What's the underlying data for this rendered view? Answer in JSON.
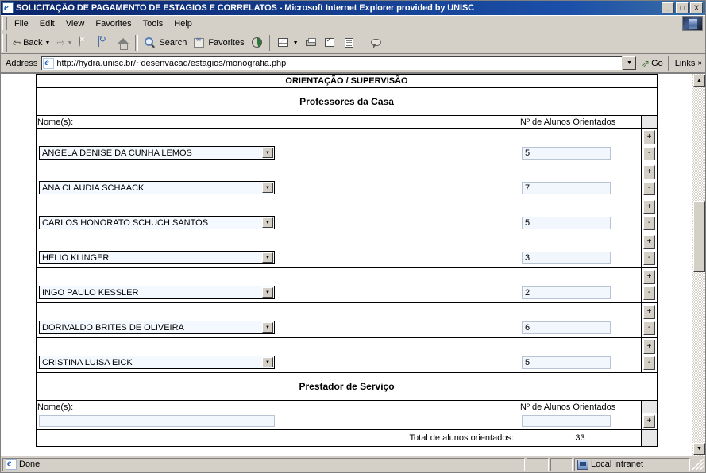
{
  "window": {
    "title": "SOLICITAÇÃO DE PAGAMENTO DE ESTAGIOS E CORRELATOS - Microsoft Internet Explorer provided by UNISC",
    "minimize_label": "_",
    "maximize_label": "□",
    "close_label": "X"
  },
  "menu": {
    "items": [
      "File",
      "Edit",
      "View",
      "Favorites",
      "Tools",
      "Help"
    ]
  },
  "toolbar": {
    "back_label": "Back",
    "forward_label": "",
    "stop_label": "",
    "refresh_label": "",
    "home_label": "",
    "search_label": "Search",
    "favorites_label": "Favorites",
    "history_label": "",
    "mail_label": "",
    "print_label": "",
    "edit_label": "",
    "discuss_label": "",
    "messenger_label": ""
  },
  "address": {
    "label": "Address",
    "url": "http://hydra.unisc.br/~desenvacad/estagios/monografia.php",
    "go_label": "Go",
    "links_label": "Links",
    "links_chevron": "»"
  },
  "page": {
    "header_band": "ORIENTAÇÃO / SUPERVISÃO",
    "section_professores": "Professores da Casa",
    "section_prestador": "Prestador de Serviço",
    "col_nome": "Nome(s):",
    "col_alunos": "Nº de Alunos Orientados",
    "plus_label": "+",
    "minus_label": "-",
    "professores": [
      {
        "nome": "ANGELA DENISE DA CUNHA LEMOS",
        "alunos": "5"
      },
      {
        "nome": "ANA CLAUDIA SCHAACK",
        "alunos": "7"
      },
      {
        "nome": "CARLOS HONORATO SCHUCH SANTOS",
        "alunos": "5"
      },
      {
        "nome": "HELIO KLINGER",
        "alunos": "3"
      },
      {
        "nome": "INGO PAULO KESSLER",
        "alunos": "2"
      },
      {
        "nome": "DORIVALDO BRITES DE OLIVEIRA",
        "alunos": "6"
      },
      {
        "nome": "CRISTINA LUISA EICK",
        "alunos": "5"
      }
    ],
    "prestador": [
      {
        "nome": "",
        "alunos": ""
      }
    ],
    "total_label": "Total de alunos orientados:",
    "total_value": "33"
  },
  "scrollbar": {
    "up_arrow": "▲",
    "down_arrow": "▼"
  },
  "statusbar": {
    "status": "Done",
    "zone": "Local intranet"
  },
  "colors": {
    "titlebar_start": "#0a246a",
    "titlebar_end": "#3a6ea5",
    "chrome": "#d4d0c8",
    "field_blue": "#f2f6fd",
    "select_blue": "#f4f8ff"
  }
}
